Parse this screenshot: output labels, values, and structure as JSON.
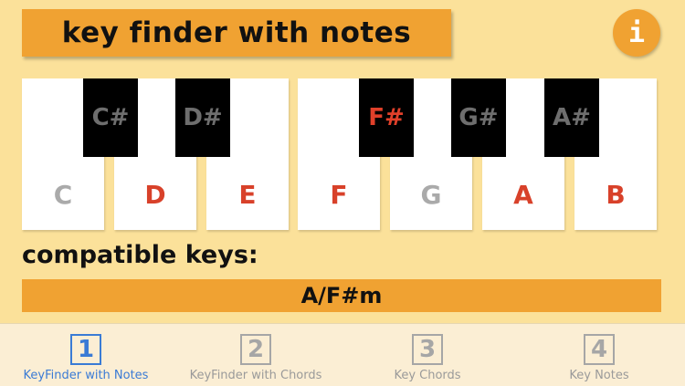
{
  "header": {
    "title": "key finder with notes",
    "info_label": "i"
  },
  "keyboard": {
    "white_keys": [
      {
        "note": "C",
        "color": "#AAAAAA"
      },
      {
        "note": "D",
        "color": "#D8412A"
      },
      {
        "note": "E",
        "color": "#D8412A"
      },
      {
        "note": "F",
        "color": "#D8412A"
      },
      {
        "note": "G",
        "color": "#AAAAAA"
      },
      {
        "note": "A",
        "color": "#D8412A"
      },
      {
        "note": "B",
        "color": "#D8412A"
      }
    ],
    "black_keys": [
      {
        "note": "C#",
        "color": "#6E6E6E"
      },
      {
        "note": "D#",
        "color": "#6E6E6E"
      },
      {
        "note": "F#",
        "color": "#E0402A"
      },
      {
        "note": "G#",
        "color": "#6E6E6E"
      },
      {
        "note": "A#",
        "color": "#6E6E6E"
      }
    ]
  },
  "compatible": {
    "label": "compatible keys:",
    "result": "A/F#m"
  },
  "tabs": [
    {
      "num": "1",
      "label": "KeyFinder with Notes",
      "active": true
    },
    {
      "num": "2",
      "label": "KeyFinder with Chords",
      "active": false
    },
    {
      "num": "3",
      "label": "Key Chords",
      "active": false
    },
    {
      "num": "4",
      "label": "Key Notes",
      "active": false
    }
  ],
  "colors": {
    "accent": "#F0A232",
    "background": "#FBE19A",
    "active_tab": "#3A7BD5"
  }
}
